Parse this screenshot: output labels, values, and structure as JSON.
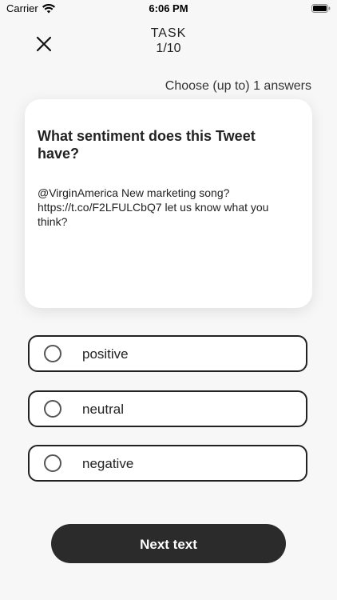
{
  "status_bar": {
    "carrier": "Carrier",
    "time": "6:06 PM",
    "icons": [
      "wifi-icon",
      "battery-icon"
    ]
  },
  "header": {
    "close_icon": "close-icon",
    "task_label": "TASK",
    "progress": "1/10"
  },
  "instructions": "Choose (up to) 1 answers",
  "card": {
    "question": "What sentiment does this Tweet have?",
    "tweet": "@VirginAmerica New marketing song? https://t.co/F2LFULCbQ7 let us know what you think?"
  },
  "options": [
    {
      "label": "positive",
      "selected": false
    },
    {
      "label": "neutral",
      "selected": false
    },
    {
      "label": "negative",
      "selected": false
    }
  ],
  "next_button": {
    "label": "Next text"
  },
  "colors": {
    "background": "#f7f7f7",
    "card": "#ffffff",
    "button": "#2b2b2b",
    "text": "#222222"
  }
}
